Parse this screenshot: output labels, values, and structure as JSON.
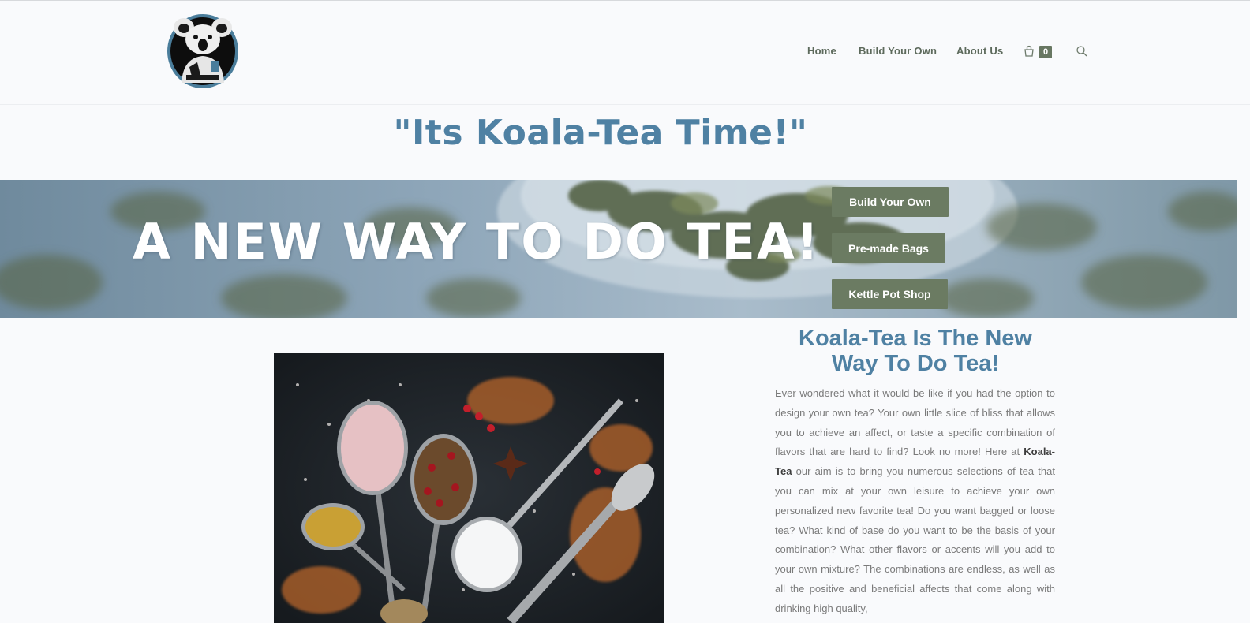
{
  "header": {
    "logo_alt": "Koala-Tea logo",
    "nav": {
      "home": "Home",
      "build": "Build Your Own",
      "about": "About Us"
    },
    "cart_count": "0",
    "cart_icon": "shopping-bag-icon",
    "search_icon": "search-icon"
  },
  "tagline": "\"Its Koala-Tea Time!\"",
  "hero": {
    "title": "A NEW WAY TO DO TEA!",
    "buttons": {
      "build": "Build Your Own",
      "premade": "Pre-made Bags",
      "kettle": "Kettle Pot Shop"
    }
  },
  "content": {
    "heading": "Koala-Tea Is The New Way To Do Tea!",
    "para_1": "Ever wondered what it would be like if you had the option to design your own tea?  Your own little slice of bliss that allows you to achieve an affect, or taste a specific combination of flavors that are hard to find?  Look no more!  Here at ",
    "brand": "Koala-Tea",
    "para_2": " our aim is to bring you numerous selections of tea that you can mix at your own leisure to achieve your own personalized new favorite tea!  Do you want bagged or loose tea?  What kind of base do you want to be the basis of your combination?  What other flavors or accents will you add to your own mixture?  The combinations are endless, as well as all the positive and beneficial affects that come along with drinking high quality,"
  },
  "colors": {
    "accent_blue": "#4f81a3",
    "button_green": "#6b7b62",
    "nav_text": "#5d6a5c"
  }
}
